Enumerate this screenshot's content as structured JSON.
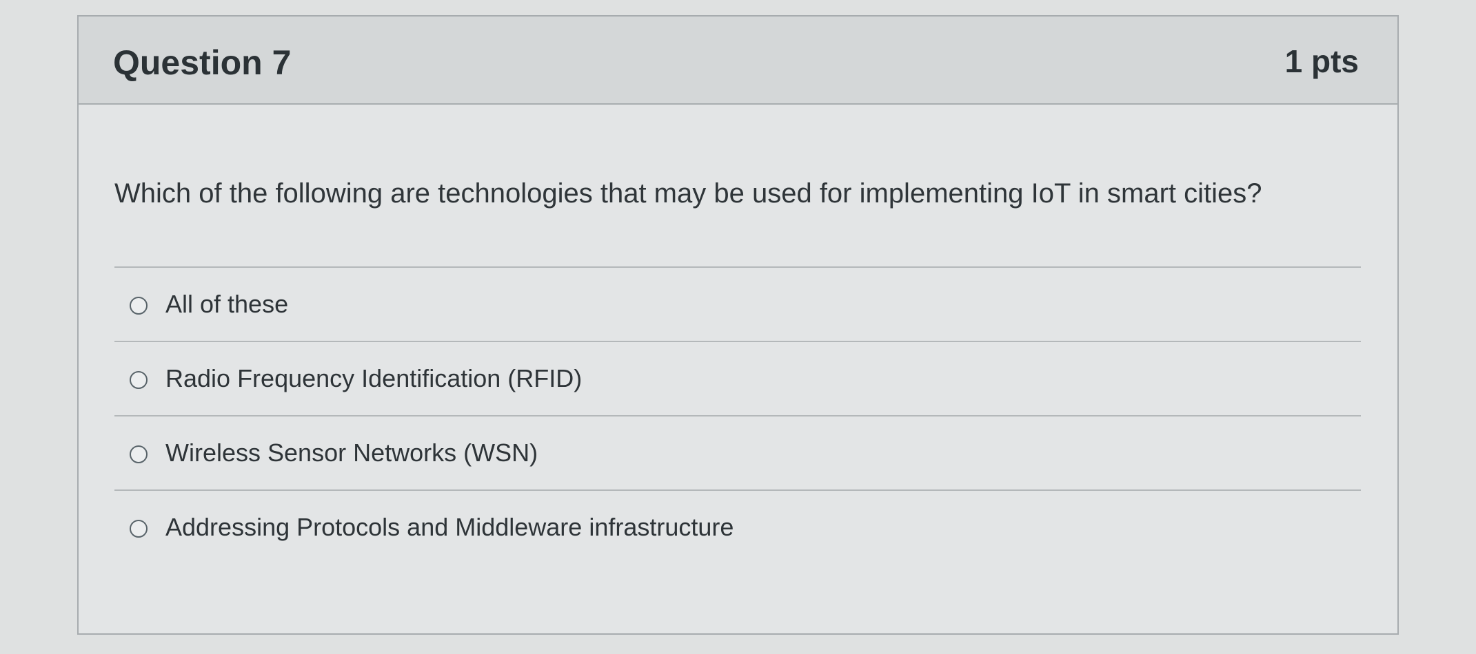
{
  "question": {
    "title": "Question 7",
    "points": "1 pts",
    "text": "Which of the following are technologies that may be used for implementing IoT in smart cities?"
  },
  "answers": [
    {
      "label": "All of these",
      "selected": false
    },
    {
      "label": "Radio Frequency Identification (RFID)",
      "selected": false
    },
    {
      "label": "Wireless Sensor Networks (WSN)",
      "selected": false
    },
    {
      "label": "Addressing Protocols and Middleware infrastructure",
      "selected": false
    }
  ]
}
